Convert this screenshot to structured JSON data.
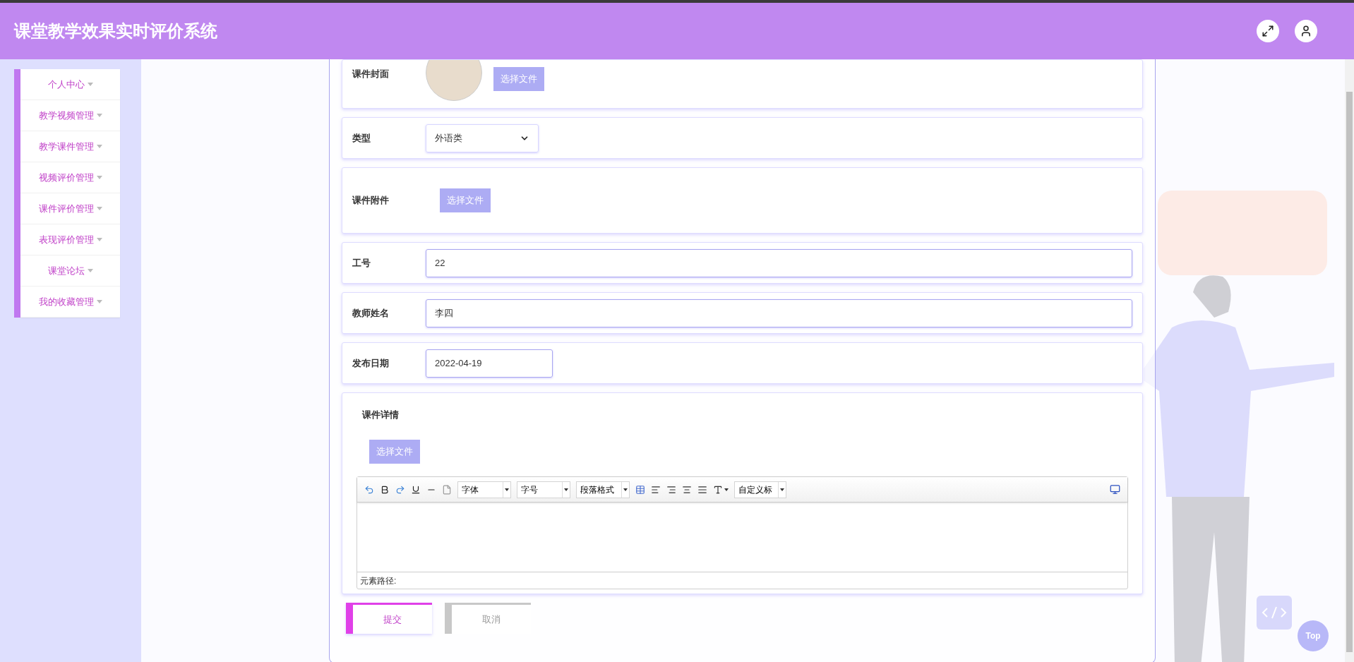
{
  "header": {
    "title": "课堂教学效果实时评价系统"
  },
  "sidebar": {
    "items": [
      {
        "label": "个人中心"
      },
      {
        "label": "教学视频管理"
      },
      {
        "label": "教学课件管理"
      },
      {
        "label": "视频评价管理"
      },
      {
        "label": "课件评价管理"
      },
      {
        "label": "表现评价管理"
      },
      {
        "label": "课堂论坛"
      },
      {
        "label": "我的收藏管理"
      }
    ]
  },
  "form": {
    "fields": [
      {
        "kind": "image",
        "label": "课件封面",
        "button": "选择文件"
      },
      {
        "kind": "select",
        "label": "类型",
        "value": "外语类"
      },
      {
        "kind": "file",
        "label": "课件附件",
        "button": "选择文件"
      },
      {
        "kind": "text",
        "label": "工号",
        "value": "22"
      },
      {
        "kind": "text",
        "label": "教师姓名",
        "value": "李四"
      },
      {
        "kind": "date",
        "label": "发布日期",
        "value": "2022-04-19"
      },
      {
        "kind": "editor",
        "label": "课件详情",
        "button": "选择文件"
      }
    ]
  },
  "editor": {
    "font": "字体",
    "size": "字号",
    "paragraph": "段落格式",
    "heading": "自定义标",
    "status": "元素路径:"
  },
  "buttons": [
    {
      "kind": "submit",
      "label": "提交"
    },
    {
      "kind": "cancel",
      "label": "取消"
    }
  ],
  "top_button": "Top"
}
